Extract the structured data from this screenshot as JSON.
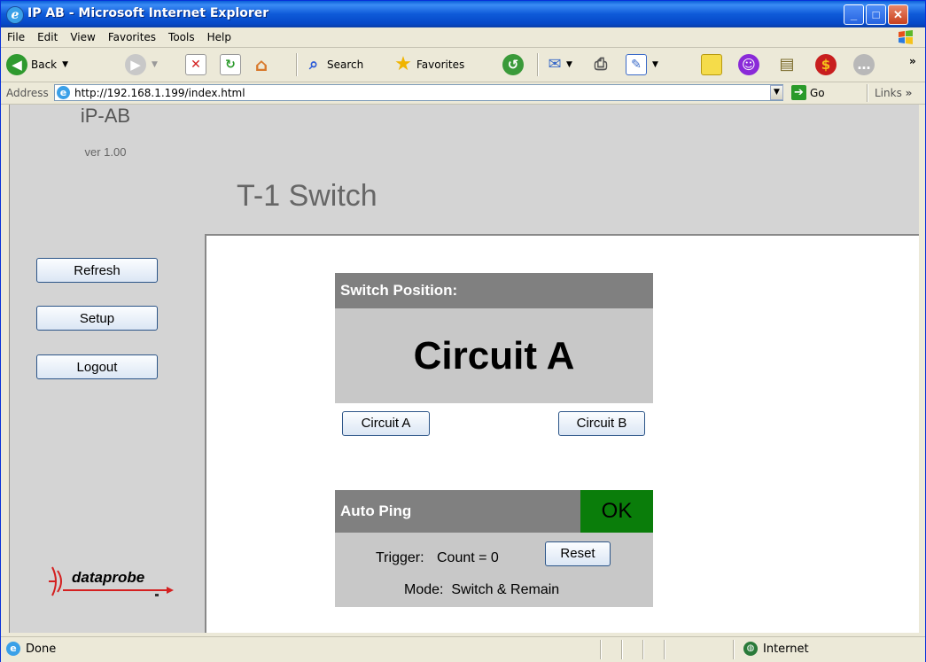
{
  "window": {
    "title": "IP AB - Microsoft Internet Explorer",
    "minimize": "_",
    "maximize": "□",
    "close": "✕"
  },
  "menu": [
    "File",
    "Edit",
    "View",
    "Favorites",
    "Tools",
    "Help"
  ],
  "toolbar": {
    "back_label": "Back",
    "search_label": "Search",
    "favorites_label": "Favorites"
  },
  "address": {
    "label": "Address",
    "url": "http://192.168.1.199/index.html",
    "go_label": "Go",
    "links_label": "Links"
  },
  "sidebar": {
    "brand": "iP-AB",
    "version": "ver 1.00",
    "buttons": [
      "Refresh",
      "Setup",
      "Logout"
    ],
    "logo_text": "dataprobe"
  },
  "page": {
    "title": "T-1 Switch",
    "switch_panel": {
      "heading": "Switch Position:",
      "current": "Circuit A",
      "btn_a": "Circuit A",
      "btn_b": "Circuit B"
    },
    "ping_panel": {
      "heading": "Auto Ping",
      "status": "OK",
      "status_color": "#0a7d0a",
      "trigger_label": "Trigger:",
      "count_text": "Count = 0",
      "reset_label": "Reset",
      "mode_text": "Mode:  Switch & Remain"
    }
  },
  "status": {
    "text": "Done",
    "zone": "Internet"
  }
}
